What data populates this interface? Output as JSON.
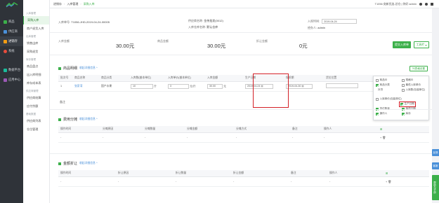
{
  "nav_primary": [
    {
      "label": "商品",
      "icon": "box-icon",
      "color": "#3cb04a"
    },
    {
      "label": "供应商",
      "icon": "supplier-icon",
      "color": "#4a90d9"
    },
    {
      "label": "进销存",
      "icon": "warehouse-icon",
      "color": "#f39c12",
      "active": true
    },
    {
      "label": "系统",
      "icon": "gear-icon",
      "color": "#e74c3c"
    },
    {
      "label": "数据平台",
      "icon": "chart-icon",
      "color": "#1abc9c"
    },
    {
      "label": "应用中心",
      "icon": "apps-icon",
      "color": "#9b59b6"
    }
  ],
  "nav_sub": {
    "groups": [
      {
        "title": "入库管理",
        "items": [
          "采购入库",
          "商户退货入库"
        ]
      },
      {
        "title": "出库管理",
        "items": [
          "销售出库",
          "采购退货"
        ]
      },
      {
        "title": "库存管理",
        "items": [
          "商品盘点",
          "出入库明细",
          "库存成本表"
        ]
      },
      {
        "title": "供应商管理",
        "items": [
          "供应商结算",
          "应付余额"
        ]
      },
      {
        "title": "基础数据",
        "items": [
          "供应商列表",
          "仓位管理"
        ]
      }
    ],
    "active": "采购入库"
  },
  "breadcrumb": [
    "进销存",
    "入库管理",
    "采购入库"
  ],
  "topbar_right": {
    "user_text": "T1056 奕新优选-总仓 | 你好 admin"
  },
  "header": {
    "order_no_label": "入库单号:",
    "order_no": "T1056-JHD-2019-04-24-00005",
    "supplier_label": "供应商名称:",
    "supplier": "金伟批发(0012)",
    "warehouse_label": "入库仓库名称:",
    "warehouse": "默认仓库",
    "date_label": "入库时间:",
    "date": "2019-04-24",
    "operator_label": "经办人:",
    "operator": "admin"
  },
  "summary": {
    "amount_label": "入库金额",
    "amount": "30.00元",
    "goods_amount_label": "商品金额",
    "goods_amount": "30.00元",
    "discount_label": "折让金额",
    "discount": "0元",
    "submit_btn": "提交入库单",
    "tools_btn": "工具栏"
  },
  "goods": {
    "title": "商品明细",
    "hide_link": "收起详细信息 ^",
    "settings_btn": "列表格设置",
    "columns": [
      "批次号",
      "商品名称",
      "商品分类",
      "入库数(基本单位)",
      "入库单价(基本单位)",
      "入库金额",
      "生产日期",
      "保质期",
      "货位位置",
      "操作"
    ],
    "rows": [
      {
        "idx": "1",
        "name": "张家湾",
        "category": "国产水果",
        "qty": "10",
        "qty_unit": "斤",
        "price": "3",
        "price_unit": "元/斤",
        "amount": "30.00",
        "prod_date": "2019-04-24",
        "expire": "2019-04-30",
        "location": ""
      }
    ],
    "remark_label": "备注"
  },
  "col_settings": [
    {
      "label": "商品ID",
      "on": false
    },
    {
      "label": "规格ID",
      "on": false
    },
    {
      "label": "商品分类",
      "on": true
    },
    {
      "label": "最低入库单价",
      "on": false
    },
    {
      "label": "补货",
      "on": false
    },
    {
      "label": "入库数(包装单位)",
      "on": false
    },
    {
      "label": "入库单价(包装单位)",
      "on": false
    },
    {
      "label": "生产日期",
      "on": true
    },
    {
      "label": "货位数量",
      "on": true
    },
    {
      "label": "保质日期",
      "on": true
    },
    {
      "label": "操作人",
      "on": true
    },
    {
      "label": "库存",
      "on": true
    }
  ],
  "fees": {
    "title": "费用分摊",
    "hide_link": "收起详细信息 ^",
    "columns": [
      "操作时间",
      "分摊原因",
      "分摊数量",
      "分摊金额",
      "分摊方式",
      "备注",
      "操作人"
    ],
    "empty": "-"
  },
  "discount_sec": {
    "title": "金额折让",
    "hide_link": "收起详细信息 ^",
    "columns": [
      "操作时间",
      "折让原因",
      "折让数量",
      "折让金额",
      "备注",
      "操作人"
    ],
    "empty": "-"
  },
  "float_tabs": [
    "反馈",
    "客服",
    "帮助与手册"
  ]
}
